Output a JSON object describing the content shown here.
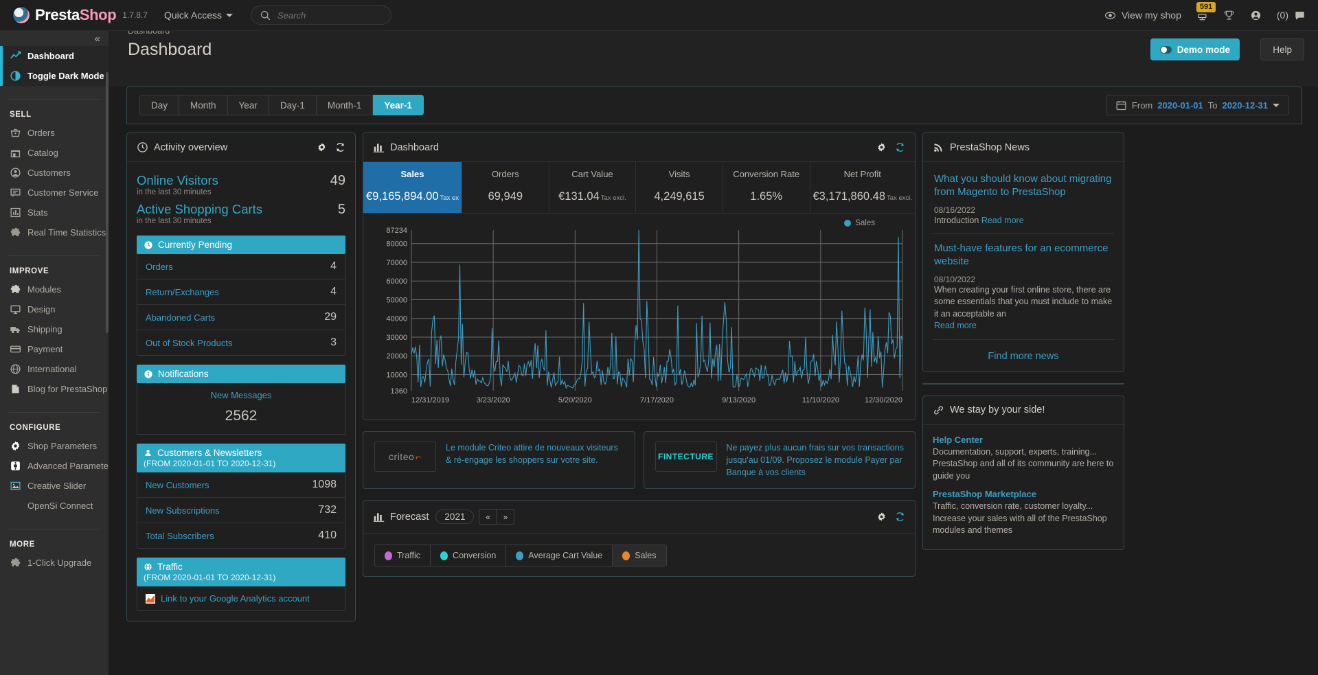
{
  "header": {
    "brand_prefix": "Presta",
    "brand_suffix": "Shop",
    "version": "1.7.8.7",
    "quick_access": "Quick Access",
    "search_placeholder": "Search",
    "view_my_shop": "View my shop",
    "cart_badge": "591",
    "messages_count": "(0)"
  },
  "sidebar": {
    "collapse_label": "«",
    "top_items": [
      {
        "label": "Dashboard",
        "icon": "trend-line-icon"
      },
      {
        "label": "Toggle Dark Mode",
        "icon": "contrast-icon"
      }
    ],
    "groups": [
      {
        "heading": "SELL",
        "items": [
          {
            "label": "Orders",
            "icon": "basket-icon"
          },
          {
            "label": "Catalog",
            "icon": "store-icon"
          },
          {
            "label": "Customers",
            "icon": "person-circle-icon"
          },
          {
            "label": "Customer Service",
            "icon": "chat-icon"
          },
          {
            "label": "Stats",
            "icon": "bar-chart-icon"
          },
          {
            "label": "Real Time Statistics",
            "icon": "puzzle-icon"
          }
        ]
      },
      {
        "heading": "IMPROVE",
        "items": [
          {
            "label": "Modules",
            "icon": "puzzle-icon"
          },
          {
            "label": "Design",
            "icon": "monitor-icon"
          },
          {
            "label": "Shipping",
            "icon": "truck-icon"
          },
          {
            "label": "Payment",
            "icon": "credit-card-icon"
          },
          {
            "label": "International",
            "icon": "globe-icon"
          },
          {
            "label": "Blog for PrestaShop",
            "icon": "page-icon"
          }
        ]
      },
      {
        "heading": "CONFIGURE",
        "items": [
          {
            "label": "Shop Parameters",
            "icon": "gear-icon"
          },
          {
            "label": "Advanced Parameters",
            "icon": "settings-square-icon"
          },
          {
            "label": "Creative Slider",
            "icon": "image-icon"
          },
          {
            "label": "OpenSi Connect",
            "icon": "none"
          }
        ]
      },
      {
        "heading": "MORE",
        "items": [
          {
            "label": "1-Click Upgrade",
            "icon": "puzzle-icon"
          }
        ]
      }
    ]
  },
  "page": {
    "breadcrumb": "Dashboard",
    "title": "Dashboard",
    "demo_mode_label": "Demo mode",
    "help_label": "Help"
  },
  "toolbar": {
    "tabs": [
      {
        "label": "Day",
        "active": false
      },
      {
        "label": "Month",
        "active": false
      },
      {
        "label": "Year",
        "active": false
      },
      {
        "label": "Day-1",
        "active": false
      },
      {
        "label": "Month-1",
        "active": false
      },
      {
        "label": "Year-1",
        "active": true
      }
    ],
    "date_from_label": "From",
    "date_from": "2020-01-01",
    "date_to_label": "To",
    "date_to": "2020-12-31"
  },
  "activity_overview": {
    "title": "Activity overview",
    "online_visitors": {
      "label": "Online Visitors",
      "value": "49",
      "sub": "in the last 30 minutes"
    },
    "active_carts": {
      "label": "Active Shopping Carts",
      "value": "5",
      "sub": "in the last 30 minutes"
    },
    "pending": {
      "heading": "Currently Pending",
      "rows": [
        {
          "label": "Orders",
          "value": "4"
        },
        {
          "label": "Return/Exchanges",
          "value": "4"
        },
        {
          "label": "Abandoned Carts",
          "value": "29"
        },
        {
          "label": "Out of Stock Products",
          "value": "3"
        }
      ]
    },
    "notifications": {
      "heading": "Notifications",
      "new_messages_label": "New Messages",
      "new_messages_value": "2562"
    },
    "customers": {
      "heading": "Customers & Newsletters",
      "subheading": "(FROM 2020-01-01 TO 2020-12-31)",
      "rows": [
        {
          "label": "New Customers",
          "value": "1098"
        },
        {
          "label": "New Subscriptions",
          "value": "732"
        },
        {
          "label": "Total Subscribers",
          "value": "410"
        }
      ]
    },
    "traffic": {
      "heading": "Traffic",
      "subheading": "(FROM 2020-01-01 TO 2020-12-31)",
      "ga_link": "Link to your Google Analytics account"
    }
  },
  "dashboard_panel": {
    "title": "Dashboard",
    "kpis": [
      {
        "name": "Sales",
        "value": "€9,165,894.00",
        "suffix": "Tax ex",
        "active": true
      },
      {
        "name": "Orders",
        "value": "69,949",
        "suffix": "",
        "active": false
      },
      {
        "name": "Cart Value",
        "value": "€131.04",
        "suffix": "Tax excl.",
        "active": false
      },
      {
        "name": "Visits",
        "value": "4,249,615",
        "suffix": "",
        "active": false
      },
      {
        "name": "Conversion Rate",
        "value": "1.65%",
        "suffix": "",
        "active": false
      },
      {
        "name": "Net Profit",
        "value": "€3,171,860.48",
        "suffix": "Tax excl.",
        "active": false
      }
    ],
    "legend": "Sales"
  },
  "chart_data": {
    "type": "line",
    "title": "Sales",
    "xlabel": "",
    "ylabel": "",
    "grid": true,
    "legend_position": "top-right",
    "series": [
      {
        "name": "Sales",
        "color": "#3d9ec4"
      }
    ],
    "ytick_labels": [
      "1360",
      "10000",
      "20000",
      "30000",
      "40000",
      "50000",
      "60000",
      "70000",
      "80000",
      "87234"
    ],
    "ylim": [
      1360,
      87234
    ],
    "xtick_labels": [
      "12/31/2019",
      "3/23/2020",
      "5/20/2020",
      "7/17/2020",
      "9/13/2020",
      "11/10/2020",
      "12/30/2020"
    ],
    "x": [
      "12/31/2019",
      "3/23/2020",
      "5/20/2020",
      "7/17/2020",
      "9/13/2020",
      "11/10/2020",
      "12/30/2020"
    ],
    "values": [
      43000,
      11000,
      72000,
      13000,
      59000,
      19000,
      5000,
      40000,
      15000,
      23000,
      48000,
      18000,
      9000,
      4000,
      36000,
      21000,
      20000,
      12000,
      71000,
      7000,
      30000,
      31000,
      10000,
      27000,
      28000,
      74000,
      8000,
      20000,
      23000,
      10000,
      38000,
      17000,
      30000,
      12000,
      75000,
      10000,
      72000,
      42000,
      33000,
      58000
    ]
  },
  "promos": [
    {
      "logo": "criteo",
      "text": "Le module Criteo attire de nouveaux visiteurs & ré-engage les shoppers sur votre site."
    },
    {
      "logo": "FINTECTURE",
      "text": "Ne payez plus aucun frais sur vos transactions jusqu'au 01/09. Proposez le module Payer par Banque à vos clients"
    }
  ],
  "forecast": {
    "title": "Forecast",
    "year": "2021",
    "prev_label": "«",
    "next_label": "»",
    "legend": [
      {
        "label": "Traffic",
        "color": "#c06bd4",
        "on": false
      },
      {
        "label": "Conversion",
        "color": "#2ad4d4",
        "on": false
      },
      {
        "label": "Average Cart Value",
        "color": "#3d9ec4",
        "on": false
      },
      {
        "label": "Sales",
        "color": "#e8882a",
        "on": true
      }
    ]
  },
  "news": {
    "title": "PrestaShop News",
    "items": [
      {
        "title": "What you should know about migrating from Magento to PrestaShop",
        "date": "08/16/2022",
        "desc": "Introduction",
        "read_more": "Read more"
      },
      {
        "title": "Must-have features for an ecommerce website",
        "date": "08/10/2022",
        "desc": "When creating your first online store, there are some essentials that you must include to make it an acceptable an",
        "read_more": "Read more"
      }
    ],
    "find_more": "Find more news"
  },
  "we_stay": {
    "title": "We stay by your side!",
    "links": [
      {
        "title": "Help Center",
        "desc": "Documentation, support, experts, training... PrestaShop and all of its community are here to guide you"
      },
      {
        "title": "PrestaShop Marketplace",
        "desc": "Traffic, conversion rate, customer loyalty... Increase your sales with all of the PrestaShop modules and themes"
      }
    ]
  }
}
